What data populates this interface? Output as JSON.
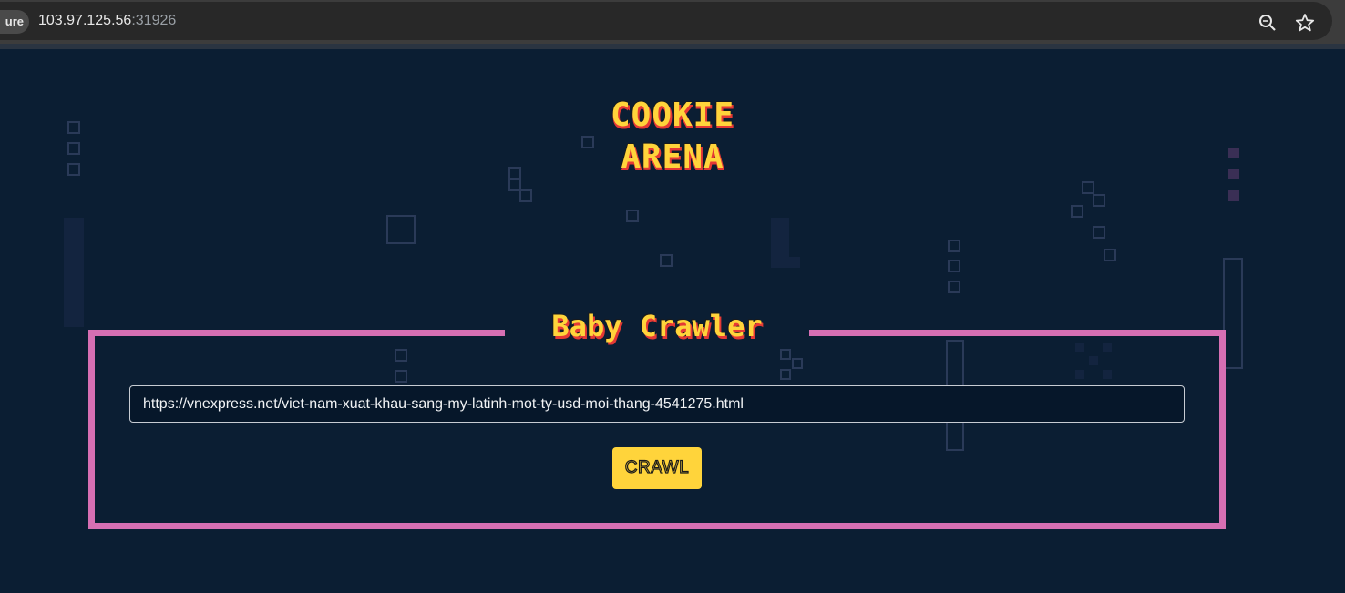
{
  "browser": {
    "security_label": "ure",
    "url_host": "103.97.125.56",
    "url_port": ":31926",
    "icons": [
      "zoom-icon",
      "bookmark-star-icon"
    ]
  },
  "page": {
    "logo_line1": "COOKIE",
    "logo_line2": "ARENA",
    "box_title": "Baby Crawler",
    "url_input_value": "https://vnexpress.net/viet-nam-xuat-khau-sang-my-latinh-mot-ty-usd-moi-thang-4541275.html",
    "crawl_button_label": "CRAWL"
  },
  "colors": {
    "background": "#0b1e33",
    "accent_yellow": "#ffd43b",
    "accent_red": "#e53935",
    "box_border_pink": "#d66fb3"
  }
}
